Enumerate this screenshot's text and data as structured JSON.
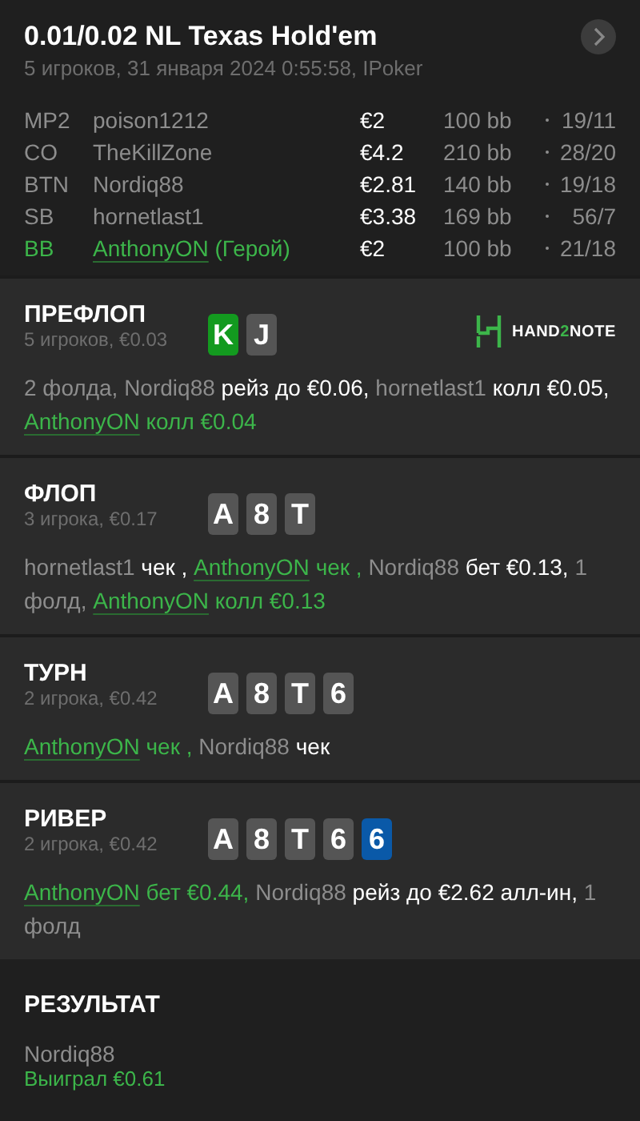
{
  "header": {
    "title": "0.01/0.02 NL Texas Hold'em",
    "subtitle": "5 игроков, 31 января 2024 0:55:58, IPoker",
    "players": [
      {
        "position": "MP2",
        "name": "poison1212",
        "hero": false,
        "stack": "€2",
        "bb": "100 bb",
        "stats": "19/11"
      },
      {
        "position": "CO",
        "name": "TheKillZone",
        "hero": false,
        "stack": "€4.2",
        "bb": "210 bb",
        "stats": "28/20"
      },
      {
        "position": "BTN",
        "name": "Nordiq88",
        "hero": false,
        "stack": "€2.81",
        "bb": "140 bb",
        "stats": "19/18"
      },
      {
        "position": "SB",
        "name": "hornetlast1",
        "hero": false,
        "stack": "€3.38",
        "bb": "169 bb",
        "stats": "56/7"
      },
      {
        "position": "BB",
        "name": "AnthonyON",
        "hero": true,
        "hero_tag": "(Герой)",
        "stack": "€2",
        "bb": "100 bb",
        "stats": "21/18"
      }
    ]
  },
  "streets": [
    {
      "title": "ПРЕФЛОП",
      "info": "5 игроков, €0.03",
      "cards": [
        {
          "rank": "K",
          "kind": "hero"
        },
        {
          "rank": "J",
          "kind": "board"
        }
      ],
      "logo": [
        "HAND",
        "2",
        "NOTE"
      ],
      "actions": [
        {
          "kind": "muted",
          "text": "2 фолда, Nordiq88"
        },
        {
          "kind": "action",
          "text": "рейз до €0.06,"
        },
        {
          "kind": "muted",
          "text": "hornetlast1"
        },
        {
          "kind": "action",
          "text": "колл €0.05,"
        },
        {
          "kind": "hero",
          "text": "AnthonyON"
        },
        {
          "kind": "hero_action",
          "text": "колл €0.04"
        }
      ]
    },
    {
      "title": "ФЛОП",
      "info": "3 игрока, €0.17",
      "cards": [
        {
          "rank": "A",
          "kind": "board"
        },
        {
          "rank": "8",
          "kind": "board"
        },
        {
          "rank": "T",
          "kind": "board"
        }
      ],
      "actions": [
        {
          "kind": "muted",
          "text": "hornetlast1"
        },
        {
          "kind": "action",
          "text": "чек ,"
        },
        {
          "kind": "hero",
          "text": "AnthonyON"
        },
        {
          "kind": "hero_action",
          "text": "чек ,"
        },
        {
          "kind": "muted",
          "text": "Nordiq88"
        },
        {
          "kind": "action",
          "text": "бет €0.13,"
        },
        {
          "kind": "muted",
          "text": "1 фолд,"
        },
        {
          "kind": "hero",
          "text": "AnthonyON"
        },
        {
          "kind": "hero_action",
          "text": "колл €0.13"
        }
      ]
    },
    {
      "title": "ТУРН",
      "info": "2 игрока, €0.42",
      "cards": [
        {
          "rank": "A",
          "kind": "board"
        },
        {
          "rank": "8",
          "kind": "board"
        },
        {
          "rank": "T",
          "kind": "board"
        },
        {
          "rank": "6",
          "kind": "board"
        }
      ],
      "actions": [
        {
          "kind": "hero",
          "text": "AnthonyON"
        },
        {
          "kind": "hero_action",
          "text": "чек ,"
        },
        {
          "kind": "muted",
          "text": "Nordiq88"
        },
        {
          "kind": "action",
          "text": "чек"
        }
      ]
    },
    {
      "title": "РИВЕР",
      "info": "2 игрока, €0.42",
      "cards": [
        {
          "rank": "A",
          "kind": "board"
        },
        {
          "rank": "8",
          "kind": "board"
        },
        {
          "rank": "T",
          "kind": "board"
        },
        {
          "rank": "6",
          "kind": "board"
        },
        {
          "rank": "6",
          "kind": "new"
        }
      ],
      "actions": [
        {
          "kind": "hero",
          "text": "AnthonyON"
        },
        {
          "kind": "hero_action",
          "text": "бет €0.44,"
        },
        {
          "kind": "muted",
          "text": "Nordiq88"
        },
        {
          "kind": "action",
          "text": "рейз до €2.62 алл-ин,"
        },
        {
          "kind": "muted",
          "text": "1 фолд"
        }
      ]
    }
  ],
  "result": {
    "title": "РЕЗУЛЬТАТ",
    "winner": "Nordiq88",
    "amount": "Выиграл €0.61"
  }
}
